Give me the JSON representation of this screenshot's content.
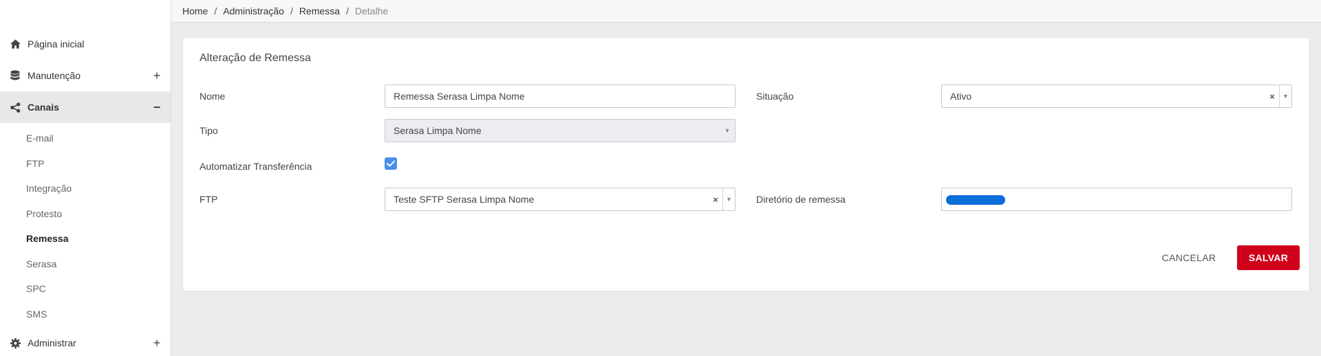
{
  "breadcrumb": {
    "items": [
      "Home",
      "Administração",
      "Remessa"
    ],
    "current": "Detalhe"
  },
  "sidebar": {
    "items": [
      {
        "label": "Página inicial",
        "icon": "home-icon"
      },
      {
        "label": "Manutenção",
        "icon": "database-icon",
        "toggle": "+"
      },
      {
        "label": "Canais",
        "icon": "share-icon",
        "toggle": "−"
      }
    ],
    "sub_items": [
      "E-mail",
      "FTP",
      "Integração",
      "Protesto",
      "Remessa",
      "Serasa",
      "SPC",
      "SMS"
    ],
    "current_sub": "Remessa",
    "bottom": {
      "label": "Administrar",
      "icon": "gear-icon",
      "toggle": "+"
    }
  },
  "form": {
    "title": "Alteração de Remessa",
    "nome_label": "Nome",
    "nome_value": "Remessa Serasa Limpa Nome",
    "situacao_label": "Situação",
    "situacao_value": "Ativo",
    "tipo_label": "Tipo",
    "tipo_value": "Serasa Limpa Nome",
    "auto_label": "Automatizar Transferência",
    "auto_checked": true,
    "ftp_label": "FTP",
    "ftp_value": "Teste SFTP Serasa Limpa Nome",
    "diretorio_label": "Diretório de remessa",
    "clear_glyph": "×",
    "arrow_glyph": "▼"
  },
  "actions": {
    "cancel": "CANCELAR",
    "save": "SALVAR"
  },
  "colors": {
    "primary_button": "#d0021b",
    "checkbox": "#4a8fe7",
    "redaction": "#0b6ed9"
  }
}
